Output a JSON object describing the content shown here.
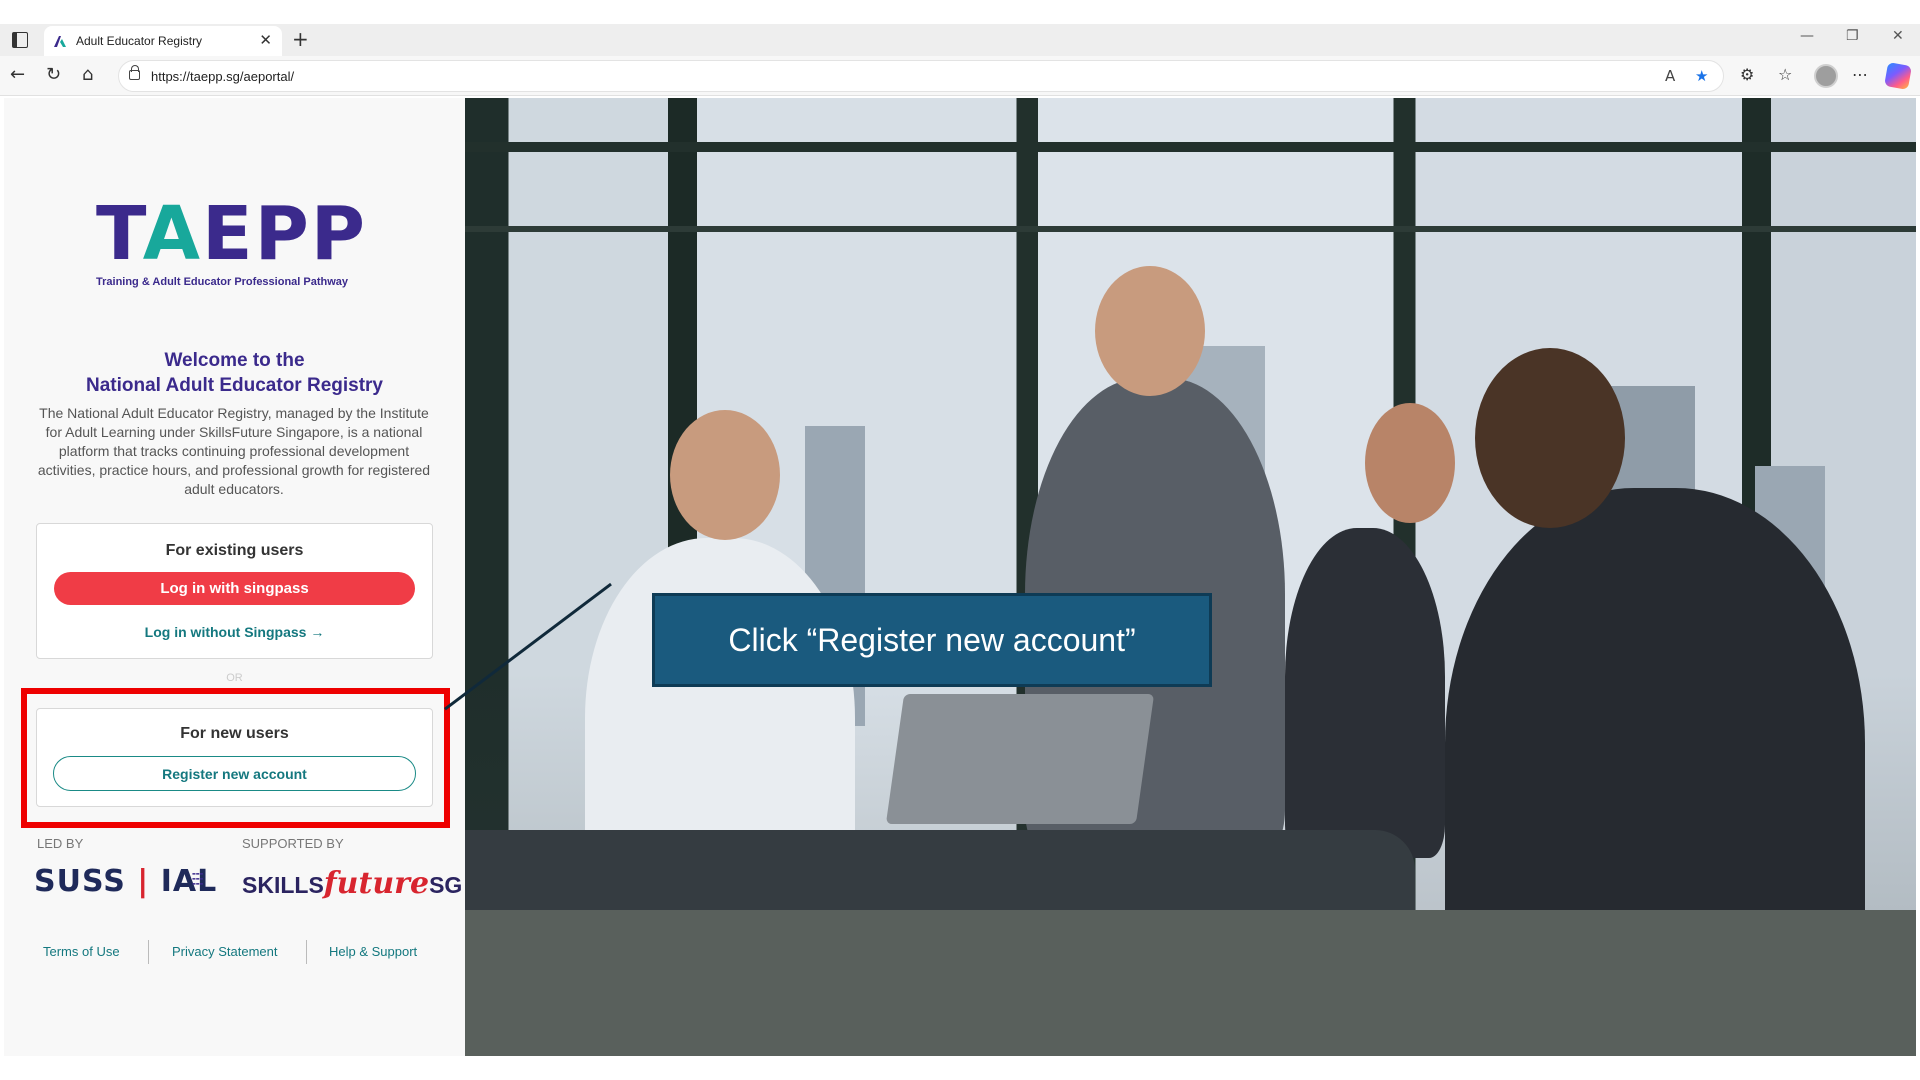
{
  "browser": {
    "tab_title": "Adult Educator Registry",
    "url": "https://taepp.sg/aeportal/"
  },
  "sidebar": {
    "logo_text_a": "T",
    "logo_text_b": "A",
    "logo_text_c": "EPP",
    "logo_tagline": "Training & Adult Educator Professional Pathway",
    "welcome_line1": "Welcome to the",
    "welcome_line2": "National Adult Educator Registry",
    "description": "The National Adult Educator Registry, managed by the Institute for Adult Learning under SkillsFuture Singapore, is a national platform that tracks continuing professional development activities, practice hours, and professional growth for registered adult educators.",
    "existing_title": "For existing users",
    "singpass_button": "Log in with singpass",
    "without_singpass_link": "Log in without Singpass →",
    "or_text": "OR",
    "new_title": "For new users",
    "register_button": "Register new account",
    "led_by": "LED BY",
    "supported_by": "SUPPORTED BY",
    "suss_logo_a": "SUSS",
    "suss_logo_b": "IAL",
    "skills_logo_a": "SKILLS",
    "skills_logo_b": "future",
    "skills_logo_c": "SG",
    "footer": [
      "Terms of Use",
      "Privacy Statement",
      "Help & Support"
    ]
  },
  "callout": {
    "text": "Click “Register new account”"
  },
  "colors": {
    "brand_purple": "#3b2a8c",
    "brand_teal": "#18a89b",
    "singpass_red": "#f03c46",
    "highlight_red": "#ee0000",
    "callout_blue": "#1a5a7e"
  }
}
